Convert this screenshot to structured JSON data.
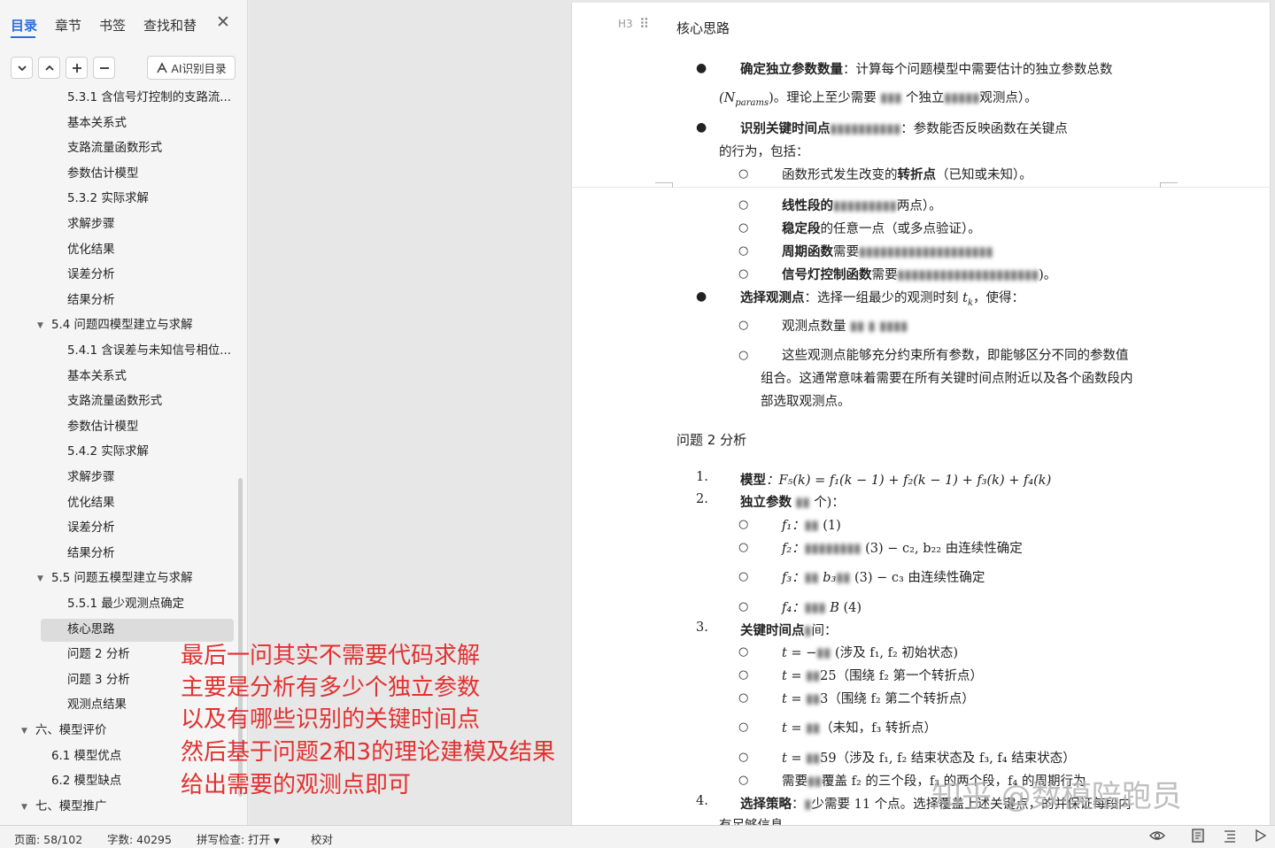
{
  "sidebar": {
    "tabs": [
      "目录",
      "章节",
      "书签",
      "查找和替"
    ],
    "toolbar": {
      "collapse_icon": "chevron-down-icon",
      "expand_icon": "chevron-up-icon",
      "ai_button": "AI识别目录"
    },
    "toc_items": [
      {
        "label": "5.3.1 含信号灯控制的支路流...",
        "indent": 76,
        "arrow": false,
        "active": false
      },
      {
        "label": "基本关系式",
        "indent": 76,
        "arrow": false,
        "active": false
      },
      {
        "label": "支路流量函数形式",
        "indent": 76,
        "arrow": false,
        "active": false
      },
      {
        "label": "参数估计模型",
        "indent": 76,
        "arrow": false,
        "active": false
      },
      {
        "label": "5.3.2 实际求解",
        "indent": 76,
        "arrow": false,
        "active": false
      },
      {
        "label": "求解步骤",
        "indent": 76,
        "arrow": false,
        "active": false
      },
      {
        "label": "优化结果",
        "indent": 76,
        "arrow": false,
        "active": false
      },
      {
        "label": "误差分析",
        "indent": 76,
        "arrow": false,
        "active": false
      },
      {
        "label": "结果分析",
        "indent": 76,
        "arrow": false,
        "active": false
      },
      {
        "label": "5.4 问题四模型建立与求解",
        "indent": 58,
        "arrow": true,
        "active": false
      },
      {
        "label": "5.4.1 含误差与未知信号相位...",
        "indent": 76,
        "arrow": false,
        "active": false
      },
      {
        "label": "基本关系式",
        "indent": 76,
        "arrow": false,
        "active": false
      },
      {
        "label": "支路流量函数形式",
        "indent": 76,
        "arrow": false,
        "active": false
      },
      {
        "label": "参数估计模型",
        "indent": 76,
        "arrow": false,
        "active": false
      },
      {
        "label": "5.4.2 实际求解",
        "indent": 76,
        "arrow": false,
        "active": false
      },
      {
        "label": "求解步骤",
        "indent": 76,
        "arrow": false,
        "active": false
      },
      {
        "label": "优化结果",
        "indent": 76,
        "arrow": false,
        "active": false
      },
      {
        "label": "误差分析",
        "indent": 76,
        "arrow": false,
        "active": false
      },
      {
        "label": "结果分析",
        "indent": 76,
        "arrow": false,
        "active": false
      },
      {
        "label": "5.5 问题五模型建立与求解",
        "indent": 58,
        "arrow": true,
        "active": false
      },
      {
        "label": "5.5.1 最少观测点确定",
        "indent": 76,
        "arrow": false,
        "active": false
      },
      {
        "label": "核心思路",
        "indent": 76,
        "arrow": false,
        "active": true
      },
      {
        "label": "问题 2 分析",
        "indent": 76,
        "arrow": false,
        "active": false
      },
      {
        "label": "问题 3 分析",
        "indent": 76,
        "arrow": false,
        "active": false
      },
      {
        "label": "观测点结果",
        "indent": 76,
        "arrow": false,
        "active": false
      },
      {
        "label": "六、模型评价",
        "indent": 40,
        "arrow": true,
        "active": false
      },
      {
        "label": "6.1 模型优点",
        "indent": 58,
        "arrow": false,
        "active": false
      },
      {
        "label": "6.2 模型缺点",
        "indent": 58,
        "arrow": false,
        "active": false
      },
      {
        "label": "七、模型推广",
        "indent": 40,
        "arrow": true,
        "active": false
      }
    ]
  },
  "document": {
    "heading_marker": "H3",
    "heading": "核心思路",
    "b1_label": "确定独立参数数量",
    "b1_text": "：计算每个问题模型中需要估计的独立参数总数",
    "b1_line2a": "(N",
    "b1_sub": "params",
    "b1_line2b": ")。理论上至少需要",
    "b1_line2c": "个独立",
    "b1_line2d": "观测点）。",
    "b2_label": "识别关键时间点",
    "b2_text": "：参数能否反映函数在关键点",
    "b2_line2": "的行为，包括：",
    "b2_s1a": "函数形式发生改变的",
    "b2_s1b": "转折点",
    "b2_s1c": "（已知或未知）。",
    "b2_s2a": "线性段的",
    "b2_s2b": "两点）。",
    "b2_s3a": "稳定段",
    "b2_s3b": "的任意一点（或多点验证）。",
    "b2_s4a": "周期函数",
    "b2_s4b": "需要",
    "b2_s5a": "信号灯控制函数",
    "b2_s5b": "需要",
    "b2_s5c": ")。",
    "b3_label": "选择观测点",
    "b3_text": "：选择一组最少的观测时刻",
    "b3_text2": "，使得：",
    "b3_s1": "观测点数量",
    "b3_s2_l1": "这些观测点能够充分约束所有参数，即能够区分不同的参数值",
    "b3_s2_l2": "组合。这通常意味着需要在所有关键时间点附近以及各个函数段内",
    "b3_s2_l3": "部选取观测点。",
    "section2_title": "问题 2 分析",
    "n1": "1.",
    "n1_label": "模型",
    "n1_formula": "：F₅(k) = f₁(k − 1) + f₂(k − 1) + f₃(k) + f₄(k)",
    "n2": "2.",
    "n2_label": "独立参数",
    "n2_suffix": "个)：",
    "p_f1": "f₁：",
    "p_f1_tail": "(1)",
    "p_f2": "f₂：",
    "p_f2_tail": "(3) − c₂, b₂₂  由连续性确定",
    "p_f3": "f₃：",
    "p_f3_mid": "b₃",
    "p_f3_tail": "(3) − c₃  由连续性确定",
    "p_f4": "f₄：",
    "p_f4_mid": "B",
    "p_f4_tail": "(4)",
    "n3": "3.",
    "n3_label": "关键时间点",
    "n3_suffix": "间：",
    "t1a": "t = −",
    "t1b": "(涉及  f₁, f₂  初始状态)",
    "t2a": "t =",
    "t2b": "25（围绕  f₂  第一个转折点）",
    "t3a": "t =",
    "t3b": "3（围绕  f₂  第二个转折点）",
    "t4a": "t =",
    "t4b": "（未知，f₃  转折点）",
    "t5a": "t =",
    "t5b": "59（涉及  f₁, f₂  结束状态及  f₃, f₄  结束状态）",
    "t6a": "需要",
    "t6b": "覆盖  f₂  的三个段，f₃  的两个段，f₄  的周期行为",
    "n4": "4.",
    "n4_label": "选择策略",
    "n4_text": "：",
    "n4_text2": "少需要 11 个点。选择覆盖上述关键点，的并保证每段内",
    "last_line": "有足够信息"
  },
  "annotation": [
    "最后一问其实不需要代码求解",
    "主要是分析有多少个独立参数",
    "以及有哪些识别的关键时间点",
    "然后基于问题2和3的理论建模及结果",
    "给出需要的观测点即可"
  ],
  "watermark": "知乎 @数模陪跑员",
  "statusbar": {
    "page": "页面: 58/102",
    "words": "字数: 40295",
    "spell": "拼写检查: 打开",
    "proof": "校对"
  }
}
